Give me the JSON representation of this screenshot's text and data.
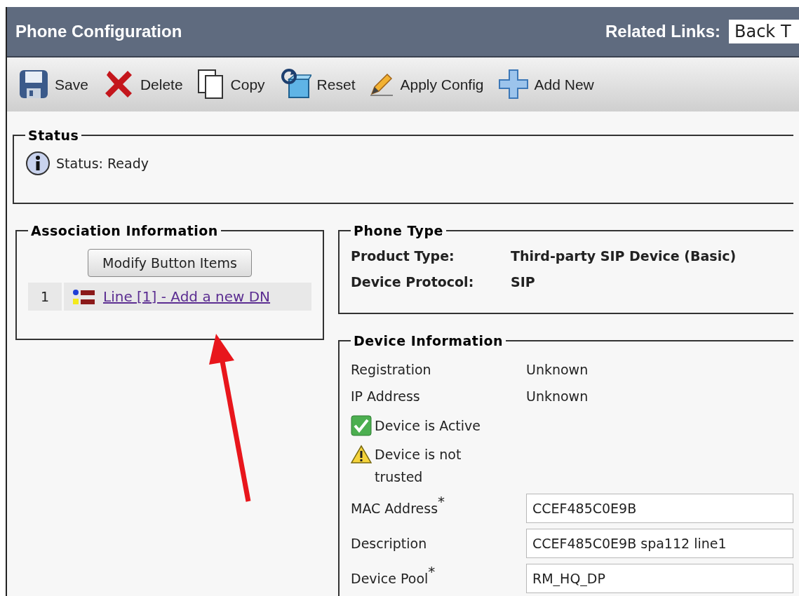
{
  "header": {
    "title": "Phone Configuration",
    "related_links_label": "Related Links:",
    "related_links_value": "Back T"
  },
  "toolbar": [
    {
      "kind": "save",
      "label": "Save"
    },
    {
      "kind": "delete",
      "label": "Delete"
    },
    {
      "kind": "copy",
      "label": "Copy"
    },
    {
      "kind": "reset",
      "label": "Reset"
    },
    {
      "kind": "apply",
      "label": "Apply Config"
    },
    {
      "kind": "add",
      "label": "Add New"
    }
  ],
  "status": {
    "legend": "Status",
    "text": "Status: Ready"
  },
  "association": {
    "legend": "Association Information",
    "button": "Modify Button Items",
    "lines": [
      {
        "index": "1",
        "label": "Line [1] - Add a new DN"
      }
    ]
  },
  "phone_type": {
    "legend": "Phone Type",
    "rows": [
      {
        "label": "Product Type:",
        "value": "Third-party SIP Device (Basic)"
      },
      {
        "label": "Device Protocol:",
        "value": "SIP"
      }
    ]
  },
  "device_information": {
    "legend": "Device Information",
    "rows": [
      {
        "kind": "text",
        "label": "Registration",
        "value": "Unknown"
      },
      {
        "kind": "text",
        "label": "IP Address",
        "value": "Unknown"
      },
      {
        "kind": "check",
        "label": "Device is Active"
      },
      {
        "kind": "warning",
        "label": "Device is not trusted"
      },
      {
        "kind": "input",
        "label": "MAC Address",
        "mark": "*",
        "value": "CCEF485C0E9B"
      },
      {
        "kind": "input",
        "label": "Description",
        "value": "CCEF485C0E9B spa112 line1"
      },
      {
        "kind": "input",
        "label": "Device Pool",
        "mark": "*",
        "value": "RM_HQ_DP"
      }
    ]
  }
}
